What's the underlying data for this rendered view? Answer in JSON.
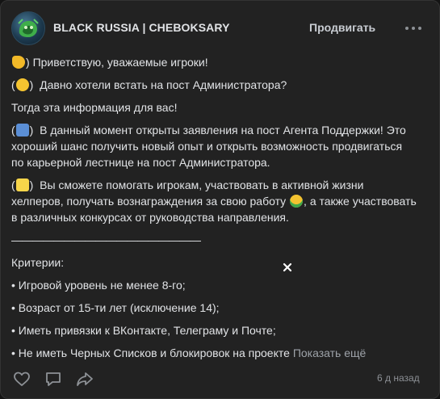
{
  "group": {
    "name": "BLACK RUSSIA | CHEBOKSARY"
  },
  "header": {
    "promote_label": "Продвигать",
    "more_icon": "more-dots-icon"
  },
  "post": {
    "line1": "Приветствую, уважаемые игроки!",
    "line2": "Давно хотели встать на пост Администратора?",
    "line3": "Тогда эта информация для вас!",
    "para1_l1": "В данный момент открыты заявления на пост Агента Поддержки! Это",
    "para1_l2": "хороший шанс получить новый опыт и открыть возможность продвигаться",
    "para1_l3": "по карьерной лестнице на пост Администратора.",
    "para2_l1": "Вы сможете помогать игрокам, участвовать в активной жизни",
    "para2_l2a": "хелперов, получать вознаграждения за свою работу",
    "para2_l2b": ", а также участвовать",
    "para2_l3": "в различных конкурсах от руководства направления.",
    "divider": "——————————————————",
    "criteria_title": "Критерии:",
    "criteria": [
      "• Игровой уровень не менее 8-го;",
      "• Возраст от 15-ти лет (исключение 14);",
      "• Иметь привязки к ВКонтакте, Телеграму и Почте;",
      "• Не иметь Черных Списков и блокировок на проекте"
    ],
    "show_more": "Показать ещё",
    "emojis": [
      "waving-hand",
      "thinking-face",
      "mailbox",
      "sparkles",
      "money-face"
    ]
  },
  "footer": {
    "time": "6 д назад"
  },
  "colors": {
    "background": "#222222",
    "text": "#e1e3e6",
    "muted": "#8d9196"
  }
}
